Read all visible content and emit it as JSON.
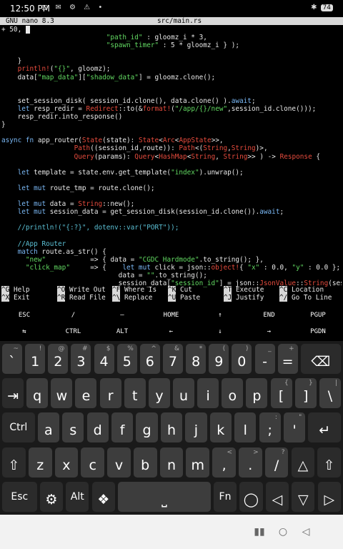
{
  "status": {
    "time": "12:50 PM",
    "battery": "74"
  },
  "nano": {
    "version": "GNU nano 8.3",
    "filename": "src/main.rs",
    "lines": [
      [
        [
          "+ 50, ",
          "n"
        ],
        [
          "",
          "cur"
        ]
      ],
      [
        [
          "                          ",
          "n"
        ],
        [
          "\"path_id\"",
          "s"
        ],
        [
          " : gloomz_i * 3,",
          "n"
        ]
      ],
      [
        [
          "                          ",
          "n"
        ],
        [
          "\"spawn_timer\"",
          "s"
        ],
        [
          " : 5 * gloomz_i } );",
          "n"
        ]
      ],
      [
        [
          "",
          "n"
        ]
      ],
      [
        [
          "    }",
          "n"
        ]
      ],
      [
        [
          "    ",
          "n"
        ],
        [
          "println!",
          "r"
        ],
        [
          "(",
          "n"
        ],
        [
          "\"{}\"",
          "s"
        ],
        [
          ", gloomz);",
          "n"
        ]
      ],
      [
        [
          "    data[",
          "n"
        ],
        [
          "\"map_data\"",
          "s"
        ],
        [
          "][",
          "n"
        ],
        [
          "\"shadow_data\"",
          "s"
        ],
        [
          "] = gloomz.clone();",
          "n"
        ]
      ],
      [
        [
          "",
          "n"
        ]
      ],
      [
        [
          "",
          "n"
        ]
      ],
      [
        [
          "    set_session_disk( session_id.clone(), data.clone() ).",
          "n"
        ],
        [
          "await",
          "k"
        ],
        [
          ";",
          "n"
        ]
      ],
      [
        [
          "    ",
          "n"
        ],
        [
          "let",
          "k"
        ],
        [
          " resp_redir = ",
          "n"
        ],
        [
          "Redirect",
          "r"
        ],
        [
          "::to(&",
          "n"
        ],
        [
          "format!",
          "r"
        ],
        [
          "(",
          "n"
        ],
        [
          "\"/app/{}/new\"",
          "s"
        ],
        [
          ",session_id.clone()));",
          "n"
        ]
      ],
      [
        [
          "    resp_redir.into_response()",
          "n"
        ]
      ],
      [
        [
          "}",
          "n"
        ]
      ],
      [
        [
          "",
          "n"
        ]
      ],
      [
        [
          "async",
          "k"
        ],
        [
          " ",
          "n"
        ],
        [
          "fn",
          "k"
        ],
        [
          " app_router(",
          "n"
        ],
        [
          "State",
          "r"
        ],
        [
          "(state): ",
          "n"
        ],
        [
          "State",
          "r"
        ],
        [
          "<",
          "n"
        ],
        [
          "Arc",
          "r"
        ],
        [
          "<",
          "n"
        ],
        [
          "AppState",
          "r"
        ],
        [
          ">>,",
          "n"
        ]
      ],
      [
        [
          "                  ",
          "n"
        ],
        [
          "Path",
          "r"
        ],
        [
          "((session_id,route)): ",
          "n"
        ],
        [
          "Path",
          "r"
        ],
        [
          "<(",
          "n"
        ],
        [
          "String",
          "r"
        ],
        [
          ",",
          "n"
        ],
        [
          "String",
          "r"
        ],
        [
          ")>,",
          "n"
        ]
      ],
      [
        [
          "                  ",
          "n"
        ],
        [
          "Query",
          "r"
        ],
        [
          "(params): ",
          "n"
        ],
        [
          "Query",
          "r"
        ],
        [
          "<",
          "n"
        ],
        [
          "HashMap",
          "r"
        ],
        [
          "<",
          "n"
        ],
        [
          "String",
          "r"
        ],
        [
          ", ",
          "n"
        ],
        [
          "String",
          "r"
        ],
        [
          ">> ) -> ",
          "n"
        ],
        [
          "Response",
          "r"
        ],
        [
          " {",
          "n"
        ]
      ],
      [
        [
          "",
          "n"
        ]
      ],
      [
        [
          "    ",
          "n"
        ],
        [
          "let",
          "k"
        ],
        [
          " template = state.env.get_template(",
          "n"
        ],
        [
          "\"index\"",
          "s"
        ],
        [
          ").unwrap();",
          "n"
        ]
      ],
      [
        [
          "",
          "n"
        ]
      ],
      [
        [
          "    ",
          "n"
        ],
        [
          "let mut",
          "k"
        ],
        [
          " route_tmp = route.clone();",
          "n"
        ]
      ],
      [
        [
          "",
          "n"
        ]
      ],
      [
        [
          "    ",
          "n"
        ],
        [
          "let mut",
          "k"
        ],
        [
          " data = ",
          "n"
        ],
        [
          "String",
          "r"
        ],
        [
          "::new();",
          "n"
        ]
      ],
      [
        [
          "    ",
          "n"
        ],
        [
          "let mut",
          "k"
        ],
        [
          " session_data = get_session_disk(session_id.clone()).",
          "n"
        ],
        [
          "await",
          "k"
        ],
        [
          ";",
          "n"
        ]
      ],
      [
        [
          "",
          "n"
        ]
      ],
      [
        [
          "    //println!(\"{:?}\", dotenv::var(\"PORT\"));",
          "c"
        ]
      ],
      [
        [
          "",
          "n"
        ]
      ],
      [
        [
          "    //App Router",
          "c"
        ]
      ],
      [
        [
          "    ",
          "n"
        ],
        [
          "match",
          "k"
        ],
        [
          " route.as_str() {",
          "n"
        ]
      ],
      [
        [
          "      ",
          "n"
        ],
        [
          "\"new\"",
          "s"
        ],
        [
          "           => { data = ",
          "n"
        ],
        [
          "\"CGDC Hardmode\"",
          "s"
        ],
        [
          ".to_string(); },",
          "n"
        ]
      ],
      [
        [
          "      ",
          "n"
        ],
        [
          "\"click_map\"",
          "s"
        ],
        [
          "     => {    ",
          "n"
        ],
        [
          "let mut",
          "k"
        ],
        [
          " click = json::",
          "n"
        ],
        [
          "object!",
          "r"
        ],
        [
          "{ ",
          "n"
        ],
        [
          "\"x\"",
          "s"
        ],
        [
          " : 0.0, ",
          "n"
        ],
        [
          "\"y\"",
          "s"
        ],
        [
          " : 0.0 };",
          "n"
        ]
      ],
      [
        [
          "                             data = ",
          "n"
        ],
        [
          "\"\"",
          "s"
        ],
        [
          ".to_string();",
          "n"
        ]
      ],
      [
        [
          "                             session_data[",
          "n"
        ],
        [
          "\"session_id\"",
          "s"
        ],
        [
          "] = json::",
          "n"
        ],
        [
          "JsonValue",
          "r"
        ],
        [
          "::",
          "n"
        ],
        [
          "String",
          "r"
        ],
        [
          "(session_",
          "n"
        ],
        [
          ">",
          "cur"
        ]
      ]
    ],
    "shortcuts": [
      [
        {
          "key": "^G",
          "label": "Help"
        },
        {
          "key": "^O",
          "label": "Write Out"
        },
        {
          "key": "^F",
          "label": "Where Is"
        },
        {
          "key": "^K",
          "label": "Cut"
        },
        {
          "key": "^T",
          "label": "Execute"
        },
        {
          "key": "^C",
          "label": "Location"
        }
      ],
      [
        {
          "key": "^X",
          "label": "Exit"
        },
        {
          "key": "^R",
          "label": "Read File"
        },
        {
          "key": "^\\",
          "label": "Replace"
        },
        {
          "key": "^U",
          "label": "Paste"
        },
        {
          "key": "^J",
          "label": "Justify"
        },
        {
          "key": "^/",
          "label": "Go To Line"
        }
      ]
    ]
  },
  "extra_keys": [
    [
      "ESC",
      "/",
      "―",
      "HOME",
      "↑",
      "END",
      "PGUP"
    ],
    [
      "⇆",
      "CTRL",
      "ALT",
      "←",
      "↓",
      "→",
      "PGDN"
    ]
  ],
  "keyboard": {
    "rows": [
      [
        {
          "m": "`",
          "a": "~"
        },
        {
          "m": "1",
          "a": "!"
        },
        {
          "m": "2",
          "a": "@"
        },
        {
          "m": "3",
          "a": "#"
        },
        {
          "m": "4",
          "a": "$"
        },
        {
          "m": "5",
          "a": "%"
        },
        {
          "m": "6",
          "a": "^"
        },
        {
          "m": "7",
          "a": "&"
        },
        {
          "m": "8",
          "a": "*"
        },
        {
          "m": "9",
          "a": "("
        },
        {
          "m": "0",
          "a": ")"
        },
        {
          "m": "-",
          "a": "_"
        },
        {
          "m": "=",
          "a": "+"
        },
        {
          "m": "⌫",
          "a": "",
          "fn": true,
          "w": 2
        }
      ],
      [
        {
          "m": "⇥",
          "a": "",
          "fn": true
        },
        {
          "m": "q",
          "a": ""
        },
        {
          "m": "w",
          "a": ""
        },
        {
          "m": "e",
          "a": ""
        },
        {
          "m": "r",
          "a": ""
        },
        {
          "m": "t",
          "a": ""
        },
        {
          "m": "y",
          "a": ""
        },
        {
          "m": "u",
          "a": ""
        },
        {
          "m": "i",
          "a": ""
        },
        {
          "m": "o",
          "a": ""
        },
        {
          "m": "p",
          "a": ""
        },
        {
          "m": "[",
          "a": "{"
        },
        {
          "m": "]",
          "a": "}"
        },
        {
          "m": "\\",
          "a": "|"
        }
      ],
      [
        {
          "m": "Ctrl",
          "a": "",
          "fn": true,
          "w": 1.5
        },
        {
          "m": "a",
          "a": ""
        },
        {
          "m": "s",
          "a": ""
        },
        {
          "m": "d",
          "a": ""
        },
        {
          "m": "f",
          "a": ""
        },
        {
          "m": "g",
          "a": ""
        },
        {
          "m": "h",
          "a": ""
        },
        {
          "m": "j",
          "a": ""
        },
        {
          "m": "k",
          "a": ""
        },
        {
          "m": "l",
          "a": ""
        },
        {
          "m": ";",
          "a": ":"
        },
        {
          "m": "'",
          "a": "\""
        },
        {
          "m": "↵",
          "a": "",
          "fn": true,
          "w": 1.5
        }
      ],
      [
        {
          "m": "⇧",
          "a": "",
          "fn": true
        },
        {
          "m": "z",
          "a": ""
        },
        {
          "m": "x",
          "a": ""
        },
        {
          "m": "c",
          "a": ""
        },
        {
          "m": "v",
          "a": ""
        },
        {
          "m": "b",
          "a": ""
        },
        {
          "m": "n",
          "a": ""
        },
        {
          "m": "m",
          "a": ""
        },
        {
          "m": ",",
          "a": "<"
        },
        {
          "m": ".",
          "a": ">"
        },
        {
          "m": "/",
          "a": "?"
        },
        {
          "m": "△",
          "a": "",
          "fn": true
        },
        {
          "m": "⇧",
          "a": "",
          "fn": true
        }
      ],
      [
        {
          "m": "Esc",
          "a": "",
          "fn": true,
          "w": 1.5
        },
        {
          "m": "⚙",
          "a": "",
          "fn": true
        },
        {
          "m": "Alt",
          "a": "",
          "fn": true
        },
        {
          "m": "❖",
          "a": "",
          "fn": true
        },
        {
          "m": "⎵",
          "a": "",
          "w": 4
        },
        {
          "m": "Fn",
          "a": "",
          "fn": true
        },
        {
          "m": "◯",
          "a": "",
          "fn": true
        },
        {
          "m": "◁",
          "a": "",
          "fn": true
        },
        {
          "m": "▽",
          "a": "",
          "fn": true
        },
        {
          "m": "▷",
          "a": "",
          "fn": true
        }
      ]
    ]
  },
  "navbar": {
    "icons": [
      "back-icon",
      "home-icon",
      "recents-icon"
    ]
  }
}
